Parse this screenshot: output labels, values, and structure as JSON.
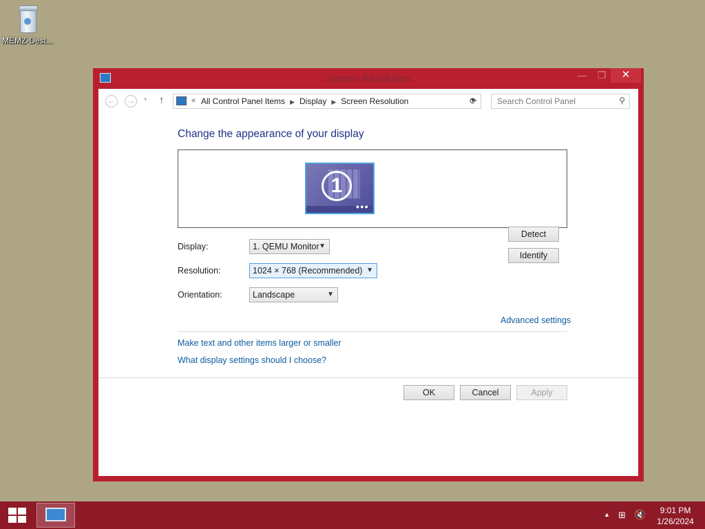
{
  "desktop": {
    "recycle_label": "MEMZ-Dest..."
  },
  "window": {
    "title": "Screen Resolution",
    "minimize": "—",
    "maximize": "❐",
    "close": "✕"
  },
  "nav": {
    "back": "←",
    "forward": "→",
    "recent": "▾",
    "up": "↑",
    "address_prefix": "«",
    "breadcrumbs": [
      "All Control Panel Items",
      "Display",
      "Screen Resolution"
    ],
    "refresh": "⟳",
    "search_placeholder": "Search Control Panel"
  },
  "main": {
    "heading": "Change the appearance of your display",
    "monitor_number": "1",
    "detect": "Detect",
    "identify": "Identify",
    "display_label": "Display:",
    "display_value": "1. QEMU Monitor",
    "resolution_label": "Resolution:",
    "resolution_value": "1024 × 768 (Recommended)",
    "orientation_label": "Orientation:",
    "orientation_value": "Landscape",
    "advanced": "Advanced settings",
    "link_text_size": "Make text and other items larger or smaller",
    "link_help": "What display settings should I choose?",
    "ok": "OK",
    "cancel": "Cancel",
    "apply": "Apply"
  },
  "taskbar": {
    "time": "9:01 PM",
    "date": "1/26/2024"
  }
}
